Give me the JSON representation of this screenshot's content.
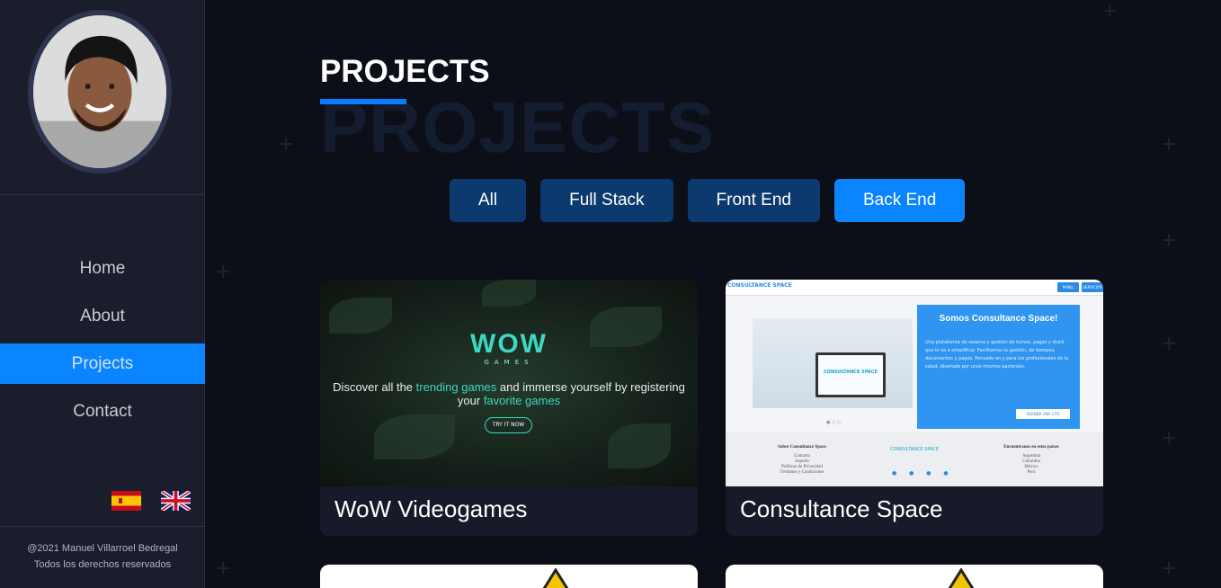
{
  "sidebar": {
    "nav": [
      {
        "label": "Home"
      },
      {
        "label": "About"
      },
      {
        "label": "Projects",
        "active": true
      },
      {
        "label": "Contact"
      }
    ],
    "languages": [
      "spain-flag-icon",
      "uk-flag-icon"
    ],
    "footer": {
      "line1": "@2021 Manuel Villarroel Bedregal",
      "line2": "Todos los derechos reservados"
    }
  },
  "main": {
    "title": "PROJECTS",
    "bg_title": "PROJECTS",
    "filters": [
      {
        "label": "All"
      },
      {
        "label": "Full Stack"
      },
      {
        "label": "Front End"
      },
      {
        "label": "Back End",
        "active": true
      }
    ],
    "projects": [
      {
        "title": "WoW Videogames",
        "preview": {
          "logo": "WOW",
          "sub": "GAMES",
          "text_pre": "Discover all the ",
          "text_hl1": "trending games",
          "text_mid": " and immerse yourself by registering your ",
          "text_hl2": "favorite games",
          "button": "TRY IT NOW"
        }
      },
      {
        "title": "Consultance Space",
        "preview": {
          "brand": "CONSULTANCE SPACE",
          "nav1": "PANEL",
          "nav2": "SERVICIOS",
          "laptop_text": "CONSULTANCE SPACE",
          "heading": "Somos Consultance Space!",
          "body": "Una plataforma de reserva y gestión de turnos, pagos y stock que le va a simplificar. Facilitamos la gestión, de tiempos, documentos y pagos. Pensado en y para los profesionales de la salud, diseñado por unos mismos pacientes.",
          "cta": "AGENDA UNA CITA",
          "col1_title": "Sobre Consultance Space",
          "col1_items": [
            "Contacto",
            "Soporte",
            "Políticas de Privacidad",
            "Términos y Condiciones"
          ],
          "footer_logo": "CONSULTANCE SPACE",
          "col3_title": "Encuentranos en estos paises",
          "col3_items": [
            "Argentina",
            "Colombia",
            "México",
            "Perú"
          ]
        }
      }
    ]
  },
  "colors": {
    "accent": "#0a84ff",
    "sidebar_bg": "#1a1d2b",
    "main_bg": "#0c0f18",
    "filter_bg": "#0c3a6e"
  }
}
